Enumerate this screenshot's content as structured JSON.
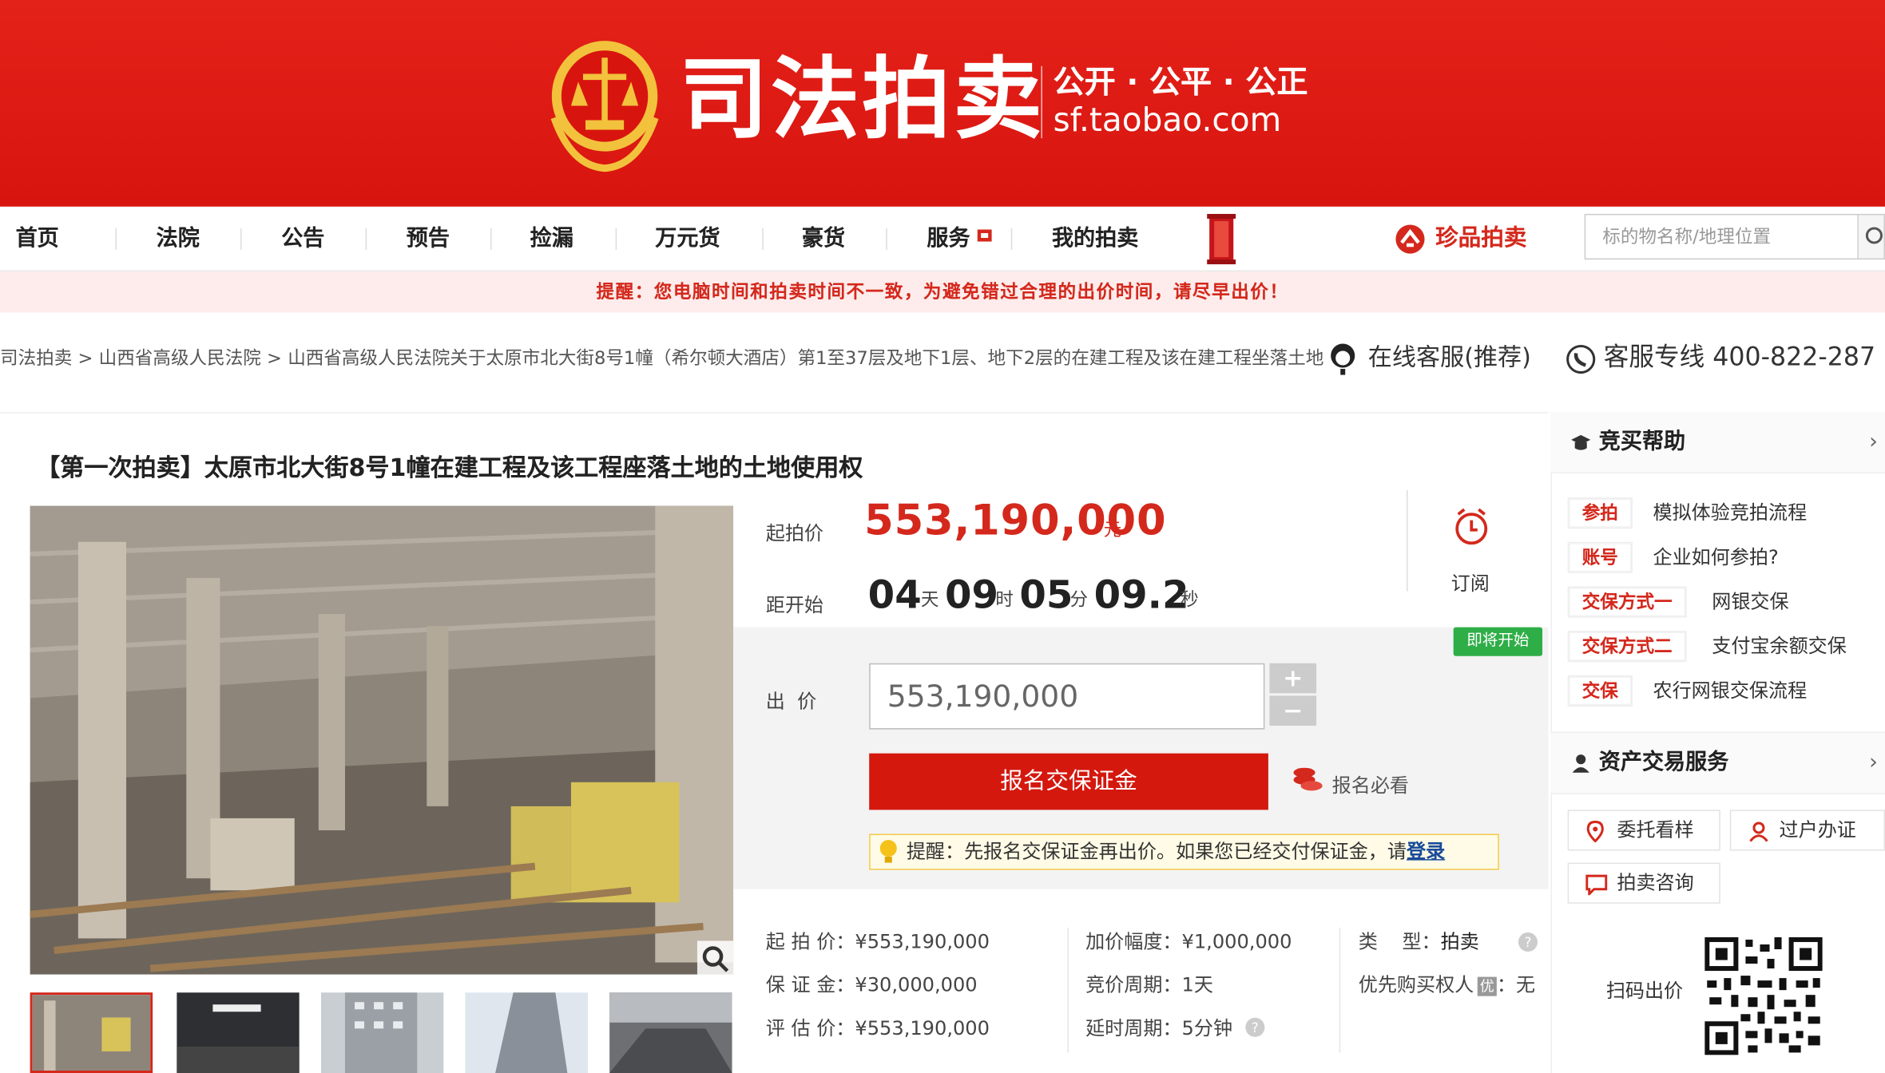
{
  "brand": {
    "name": "司法拍卖",
    "slogan": "公开 · 公平 · 公正",
    "domain": "sf.taobao.com"
  },
  "nav": {
    "items": [
      "首页",
      "法院",
      "公告",
      "预告",
      "捡漏",
      "万元货",
      "豪货",
      "服务",
      "我的拍卖"
    ],
    "zhenpin": "珍品拍卖",
    "search_placeholder": "标的物名称/地理位置"
  },
  "alert": "提醒：您电脑时间和拍卖时间不一致，为避免错过合理的出价时间，请尽早出价！",
  "breadcrumb": {
    "items": [
      "司法拍卖",
      "山西省高级人民法院",
      "山西省高级人民法院关于太原市北大街8号1幢（希尔顿大酒店）第1至37层及地下1层、地下2层的在建工程及该在建工程坐落土地"
    ],
    "sep": ">"
  },
  "service": {
    "online": "在线客服(推荐)",
    "hotline": "客服专线 400-822-287"
  },
  "item": {
    "title": "【第一次拍卖】太原市北大街8号1幢在建工程及该工程座落土地的土地使用权"
  },
  "price": {
    "label": "起拍价",
    "value": "553,190,000",
    "unit": "元"
  },
  "countdown": {
    "label": "距开始",
    "days": "04",
    "day_u": "天",
    "hours": "09",
    "hour_u": "时",
    "mins": "05",
    "min_u": "分",
    "secs": "09.2",
    "sec_u": "秒"
  },
  "subscribe": "订阅",
  "status_badge": "即将开始",
  "bid": {
    "label": "出  价",
    "value": "553,190,000",
    "plus": "+",
    "minus": "−",
    "register": "报名交保证金",
    "must_read": "报名必看",
    "tip_prefix": "提醒：先报名交保证金再出价。如果您已经交付保证金，请",
    "tip_login": "登录"
  },
  "details": {
    "start": {
      "label": "起 拍 价：",
      "value": "¥553,190,000"
    },
    "deposit": {
      "label": "保 证 金：",
      "value": "¥30,000,000"
    },
    "appraise": {
      "label": "评 估 价：",
      "value": "¥553,190,000"
    },
    "increment": {
      "label": "加价幅度：",
      "value": "¥1,000,000"
    },
    "cycle": {
      "label": "竞价周期：",
      "value": "1天"
    },
    "delay": {
      "label": "延时周期：",
      "value": "5分钟"
    },
    "type": {
      "label": "类    型：",
      "value": "拍卖"
    },
    "priority": {
      "label": "优先购买权人",
      "badge": "优",
      "value": "：无"
    }
  },
  "help": {
    "title": "竞买帮助",
    "rows": [
      {
        "tag": "参拍",
        "text": "模拟体验竞拍流程"
      },
      {
        "tag": "账号",
        "text": "企业如何参拍?"
      },
      {
        "tag": "交保方式一",
        "text": "网银交保"
      },
      {
        "tag": "交保方式二",
        "text": "支付宝余额交保"
      },
      {
        "tag": "交保",
        "text": "农行网银交保流程"
      }
    ]
  },
  "asset": {
    "title": "资产交易服务",
    "buttons": [
      "委托看样",
      "过户办证",
      "拍卖咨询"
    ]
  },
  "qr": {
    "label": "扫码出价"
  },
  "colors": {
    "brand_red": "#d4281c",
    "banner_red": "#e3221a",
    "badge_green": "#2fae48",
    "gold": "#f4c542"
  }
}
